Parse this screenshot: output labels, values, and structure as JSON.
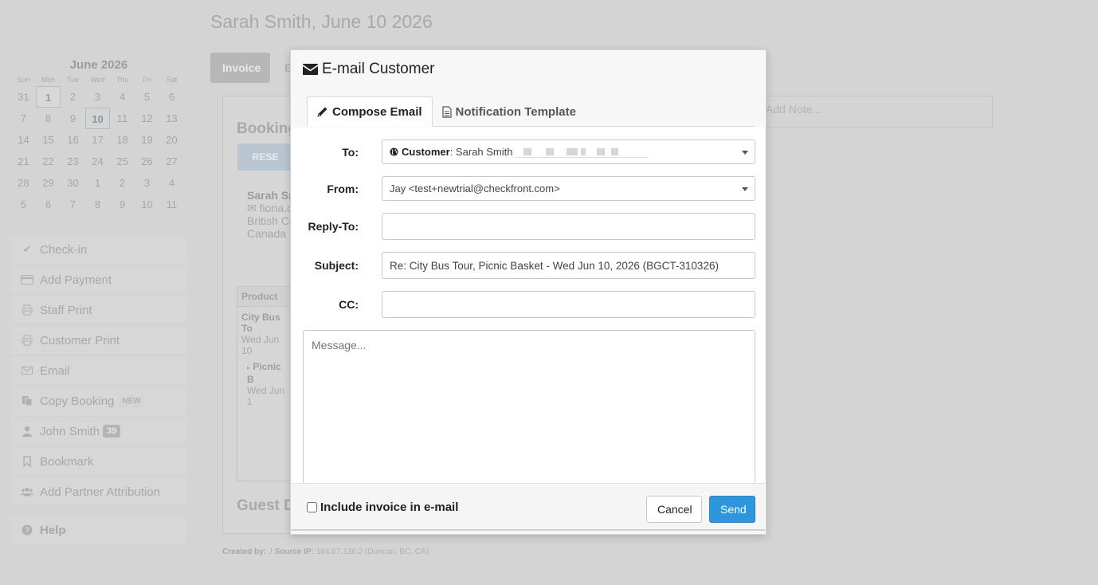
{
  "page": {
    "title": "Sarah Smith, June 10 2026"
  },
  "calendar": {
    "month": "June 2026",
    "weekdays": [
      "Sun",
      "Mon",
      "Tue",
      "Wed",
      "Thu",
      "Fri",
      "Sat"
    ],
    "weeks": [
      [
        "31",
        "1",
        "2",
        "3",
        "4",
        "5",
        "6"
      ],
      [
        "7",
        "8",
        "9",
        "10",
        "11",
        "12",
        "13"
      ],
      [
        "14",
        "15",
        "16",
        "17",
        "18",
        "19",
        "20"
      ],
      [
        "21",
        "22",
        "23",
        "24",
        "25",
        "26",
        "27"
      ],
      [
        "28",
        "29",
        "30",
        "1",
        "2",
        "3",
        "4"
      ],
      [
        "5",
        "6",
        "7",
        "8",
        "9",
        "10",
        "11"
      ]
    ],
    "today": "1",
    "selected": "10"
  },
  "sidebar": {
    "items": [
      {
        "label": "Check-in",
        "icon": "check-icon"
      },
      {
        "label": "Add Payment",
        "icon": "credit-card-icon"
      },
      {
        "label": "Staff Print",
        "icon": "printer-icon"
      },
      {
        "label": "Customer Print",
        "icon": "printer-icon"
      },
      {
        "label": "Email",
        "icon": "envelope-icon"
      },
      {
        "label": "Copy Booking",
        "icon": "copy-icon",
        "badge": "NEW"
      },
      {
        "label": "John Smith",
        "icon": "user-icon",
        "count": "39"
      },
      {
        "label": "Bookmark",
        "icon": "bookmark-icon"
      },
      {
        "label": "Add Partner Attribution",
        "icon": "users-icon"
      }
    ],
    "help": "Help"
  },
  "background": {
    "tab_invoice": "Invoice",
    "tab_second": "E",
    "booking_heading": "Booking",
    "booking_button": "RESE",
    "customer_name": "Sarah Sm",
    "customer_email": "fiona.c",
    "customer_region": "British Co",
    "customer_country": "Canada",
    "table_header": "Product",
    "row1_title": "City Bus To",
    "row1_date": "Wed Jun 10",
    "row2_title": "Picnic B",
    "row2_date": "Wed Jun 1",
    "guest_heading": "Guest D",
    "note_placeholder": "Add Note...",
    "footer_created_label": "Created by:",
    "footer_created_value": "J",
    "footer_source_label": "Source IP:",
    "footer_source_value": "184.67.136.2 (Duncan, BC, CA)"
  },
  "modal": {
    "title": "E-mail Customer",
    "tabs": {
      "compose": "Compose Email",
      "template": "Notification Template"
    },
    "labels": {
      "to": "To:",
      "from": "From:",
      "reply_to": "Reply-To:",
      "subject": "Subject:",
      "cc": "CC:"
    },
    "to": {
      "prefix": "Customer",
      "name": "Sarah Smith"
    },
    "from": "Jay <test+newtrial@checkfront.com>",
    "reply_to": "",
    "subject": "Re: City Bus Tour, Picnic Basket - Wed Jun 10, 2026 (BGCT-310326)",
    "cc": "",
    "message_placeholder": "Message...",
    "include_invoice": "Include invoice in e-mail",
    "include_invoice_checked": false,
    "cancel": "Cancel",
    "send": "Send",
    "accent_color": "#2e96dc"
  }
}
